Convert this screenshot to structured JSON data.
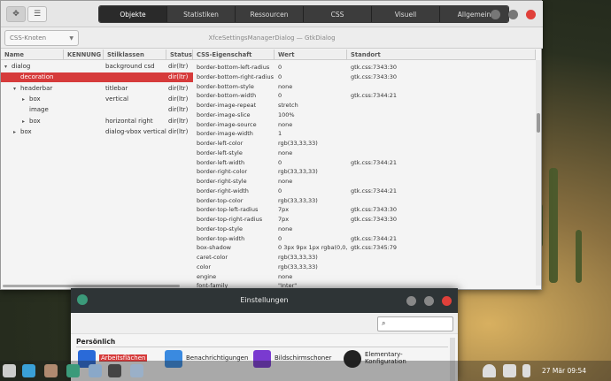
{
  "inspector": {
    "tabs": [
      {
        "label": "Objekte",
        "active": true
      },
      {
        "label": "Statistiken",
        "active": false
      },
      {
        "label": "Ressourcen",
        "active": false
      },
      {
        "label": "CSS",
        "active": false
      },
      {
        "label": "Visuell",
        "active": false
      },
      {
        "label": "Allgemein",
        "active": false
      }
    ],
    "combo_label": "CSS-Knoten",
    "subtitle": "XfceSettingsManagerDialog — GtkDialog",
    "left_columns": [
      "Name",
      "KENNUNG",
      "Stilklassen",
      "Status"
    ],
    "right_columns": [
      "CSS-Eigenschaft",
      "Wert",
      "Standort"
    ],
    "nodes": [
      {
        "tri": "▾",
        "indent": 0,
        "name": "dialog",
        "classes": "background csd",
        "state": "dir(ltr)",
        "selected": false
      },
      {
        "tri": "",
        "indent": 1,
        "name": "decoration",
        "classes": "",
        "state": "dir(ltr)",
        "selected": true
      },
      {
        "tri": "▾",
        "indent": 1,
        "name": "headerbar",
        "classes": "titlebar",
        "state": "dir(ltr)",
        "selected": false
      },
      {
        "tri": "▸",
        "indent": 2,
        "name": "box",
        "classes": "vertical",
        "state": "dir(ltr)",
        "selected": false
      },
      {
        "tri": "",
        "indent": 2,
        "name": "image",
        "classes": "",
        "state": "dir(ltr)",
        "selected": false
      },
      {
        "tri": "▸",
        "indent": 2,
        "name": "box",
        "classes": "horizontal right",
        "state": "dir(ltr)",
        "selected": false
      },
      {
        "tri": "▸",
        "indent": 1,
        "name": "box",
        "classes": "dialog-vbox vertical",
        "state": "dir(ltr)",
        "selected": false
      }
    ],
    "properties": [
      {
        "p": "border-bottom-left-radius",
        "v": "0",
        "s": "gtk.css:7343:30"
      },
      {
        "p": "border-bottom-right-radius",
        "v": "0",
        "s": "gtk.css:7343:30"
      },
      {
        "p": "border-bottom-style",
        "v": "none",
        "s": ""
      },
      {
        "p": "border-bottom-width",
        "v": "0",
        "s": "gtk.css:7344:21"
      },
      {
        "p": "border-image-repeat",
        "v": "stretch",
        "s": ""
      },
      {
        "p": "border-image-slice",
        "v": "100%",
        "s": ""
      },
      {
        "p": "border-image-source",
        "v": "none",
        "s": ""
      },
      {
        "p": "border-image-width",
        "v": "1",
        "s": ""
      },
      {
        "p": "border-left-color",
        "v": "rgb(33,33,33)",
        "s": ""
      },
      {
        "p": "border-left-style",
        "v": "none",
        "s": ""
      },
      {
        "p": "border-left-width",
        "v": "0",
        "s": "gtk.css:7344:21"
      },
      {
        "p": "border-right-color",
        "v": "rgb(33,33,33)",
        "s": ""
      },
      {
        "p": "border-right-style",
        "v": "none",
        "s": ""
      },
      {
        "p": "border-right-width",
        "v": "0",
        "s": "gtk.css:7344:21"
      },
      {
        "p": "border-top-color",
        "v": "rgb(33,33,33)",
        "s": ""
      },
      {
        "p": "border-top-left-radius",
        "v": "7px",
        "s": "gtk.css:7343:30"
      },
      {
        "p": "border-top-right-radius",
        "v": "7px",
        "s": "gtk.css:7343:30"
      },
      {
        "p": "border-top-style",
        "v": "none",
        "s": ""
      },
      {
        "p": "border-top-width",
        "v": "0",
        "s": "gtk.css:7344:21"
      },
      {
        "p": "box-shadow",
        "v": "0 3px 9px 1px rgba(0,0,0,...",
        "s": "gtk.css:7345:79"
      },
      {
        "p": "caret-color",
        "v": "rgb(33,33,33)",
        "s": ""
      },
      {
        "p": "color",
        "v": "rgb(33,33,33)",
        "s": ""
      },
      {
        "p": "engine",
        "v": "none",
        "s": ""
      },
      {
        "p": "font-family",
        "v": "\"Inter\"",
        "s": ""
      }
    ]
  },
  "settings": {
    "title": "Einstellungen",
    "search_icon": "search-icon",
    "category": "Persönlich",
    "items": [
      {
        "label": "Arbeitsflächen",
        "color": "#2a6ad8",
        "highlight": true
      },
      {
        "label": "Benachrichtigungen",
        "color": "#3a8ae0",
        "highlight": false
      },
      {
        "label": "Bildschirmschoner",
        "color": "#7a3ad0",
        "highlight": false
      },
      {
        "label": "Elementary-\nKonfiguration",
        "color": "#222222",
        "highlight": false
      }
    ]
  },
  "taskbar": {
    "clock": "27 Mär 09:54"
  },
  "colors": {
    "accent": "#d63b3b",
    "dark": "#2e3436"
  }
}
